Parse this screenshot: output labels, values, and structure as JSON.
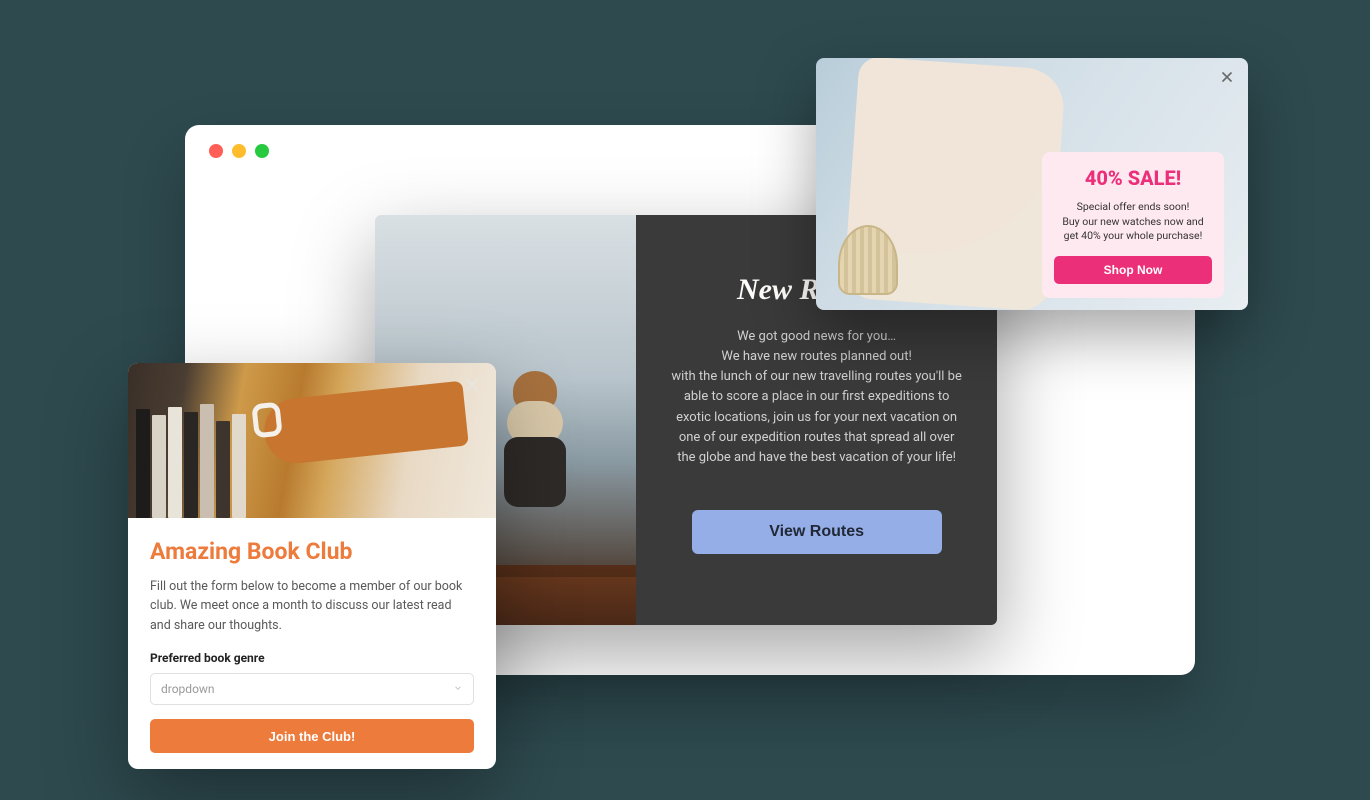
{
  "book": {
    "title": "Amazing Book Club",
    "description": "Fill out the form below to become a member of our book club. We meet once a month to discuss our latest read and share our thoughts.",
    "genre_label": "Preferred book genre",
    "select_placeholder": "dropdown",
    "cta": "Join the Club!"
  },
  "routes": {
    "title": "New Routes!",
    "text": "We got good news for you…\nWe have new routes planned out!\nwith the lunch of our new travelling routes you'll be able to score a place in our first expeditions to exotic locations, join us for your next vacation on one of our expedition routes that spread all over the globe and have the best vacation of your life!",
    "cta": "View Routes"
  },
  "sale": {
    "title": "40% SALE!",
    "text": "Special offer ends soon!\nBuy our new watches now and get 40% your whole purchase!",
    "cta": "Shop Now"
  }
}
